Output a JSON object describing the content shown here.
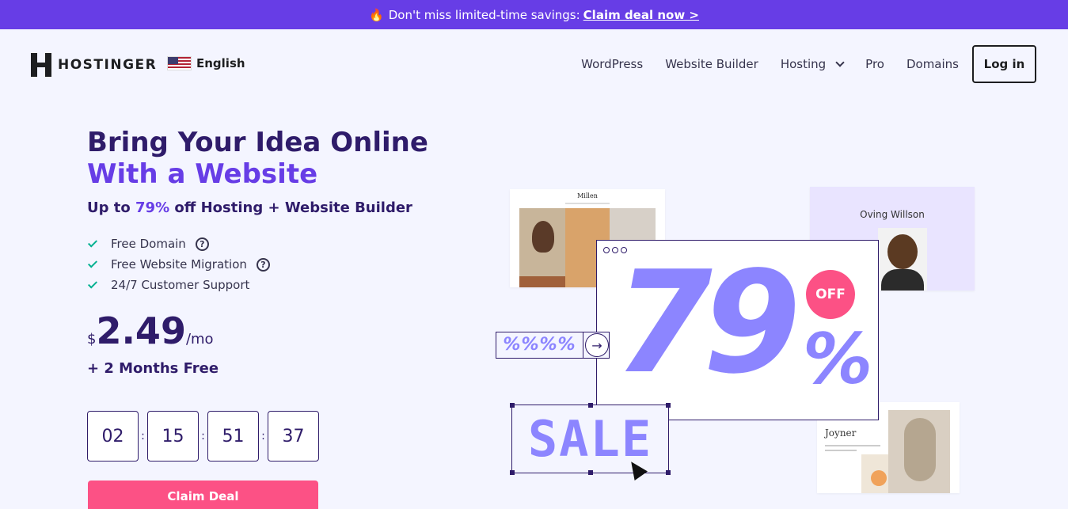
{
  "promo": {
    "icon": "flame-icon",
    "text": "Don't miss limited-time savings:",
    "link": "Claim deal now >"
  },
  "nav": {
    "logo_text": "HOSTINGER",
    "language": "English",
    "items": [
      "WordPress",
      "Website Builder",
      "Hosting",
      "Pro",
      "Domains"
    ],
    "login_label": "Log in"
  },
  "hero": {
    "title_line1": "Bring Your Idea Online",
    "title_line2": "With a Website",
    "subtitle_pre": "Up to ",
    "subtitle_pct": "79%",
    "subtitle_post": " off Hosting + Website Builder",
    "features": [
      "Free Domain",
      "Free Website Migration",
      "24/7 Customer Support"
    ],
    "help_glyph": "?",
    "price": {
      "currency": "$",
      "amount": "2.49",
      "period": "/mo"
    },
    "bonus": "+ 2 Months Free",
    "countdown": [
      "02",
      "15",
      "51",
      "37"
    ],
    "separator": ":",
    "cta_label": "Claim Deal"
  },
  "illustration": {
    "card1_title": "Millen",
    "card2_title": "Oving Willson",
    "card3_title": "Joyner",
    "big_number": "79",
    "big_percent": "%",
    "off_badge": "OFF",
    "percents_tag": "%%%%",
    "arrow": "→",
    "sale_text": "SALE"
  },
  "colors": {
    "brand": "#673de6",
    "dark": "#2f1c6a",
    "accent": "#8c85ff",
    "pink": "#fc5185",
    "check": "#00b090"
  }
}
